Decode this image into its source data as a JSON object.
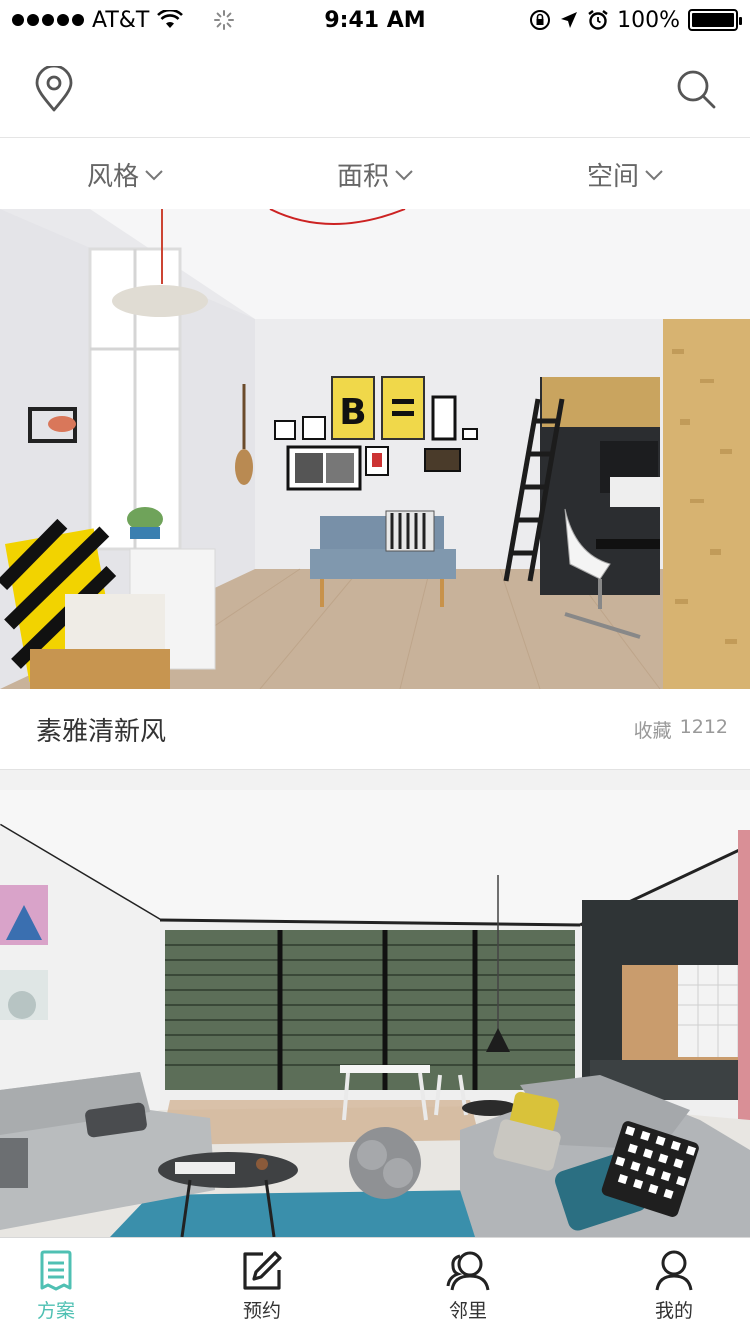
{
  "status_bar": {
    "carrier": "AT&T",
    "time": "9:41 AM",
    "battery": "100%"
  },
  "nav": {
    "left_icon": "location-pin-icon",
    "right_icon": "search-icon"
  },
  "filters": [
    {
      "label": "风格"
    },
    {
      "label": "面积"
    },
    {
      "label": "空间"
    }
  ],
  "cards": [
    {
      "title": "素雅清新风",
      "fav_label": "收藏",
      "fav_count": "1212"
    },
    {
      "title": "",
      "fav_label": "",
      "fav_count": ""
    }
  ],
  "tabs": [
    {
      "label": "方案",
      "icon": "document-list-icon",
      "active": true
    },
    {
      "label": "预约",
      "icon": "edit-square-icon",
      "active": false
    },
    {
      "label": "邻里",
      "icon": "people-icon",
      "active": false
    },
    {
      "label": "我的",
      "icon": "person-icon",
      "active": false
    }
  ],
  "colors": {
    "accent": "#4fc0b3",
    "text": "#333333",
    "muted": "#999999",
    "divider": "#e5e5e5"
  }
}
